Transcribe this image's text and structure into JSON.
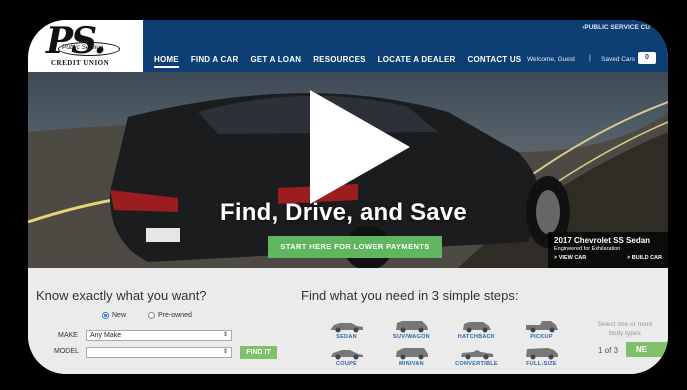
{
  "header": {
    "logo_letters": "PS.",
    "logo_tagline": "Public Service",
    "logo_subtitle": "CREDIT UNION",
    "top_link": "‹PUBLIC SERVICE CU",
    "nav": [
      "HOME",
      "FIND A CAR",
      "GET A LOAN",
      "RESOURCES",
      "LOCATE A DEALER",
      "CONTACT US"
    ],
    "welcome": "Welcome, Guest",
    "separator": "|",
    "saved_label": "Saved Cars",
    "saved_count": "0"
  },
  "hero": {
    "headline": "Find, Drive, and Save",
    "cta": "START HERE FOR LOWER PAYMENTS",
    "car_name": "2017 Chevrolet SS Sedan",
    "car_tagline": "Engineered for Exhilaration",
    "view_car": "> VIEW CAR",
    "build_car": "> BUILD CAR"
  },
  "search": {
    "title": "Know exactly what you want?",
    "radio_new": "New",
    "radio_preowned": "Pre-owned",
    "make_label": "MAKE",
    "make_value": "Any Make",
    "model_label": "MODEL",
    "model_value": "",
    "find_button": "FIND IT"
  },
  "steps": {
    "title": "Find what you need in 3 simple steps:",
    "body_types": [
      "SEDAN",
      "SUV/WAGON",
      "HATCHBACK",
      "PICKUP",
      "COUPE",
      "MINIVAN",
      "CONVERTIBLE",
      "FULL-SIZE"
    ],
    "hint": "Select one or more body types",
    "pager": "1 of 3",
    "next_button": "NE"
  },
  "colors": {
    "header_bg": "#0d3f74",
    "accent_green": "#5fb65f",
    "link_blue": "#2a66b2"
  }
}
